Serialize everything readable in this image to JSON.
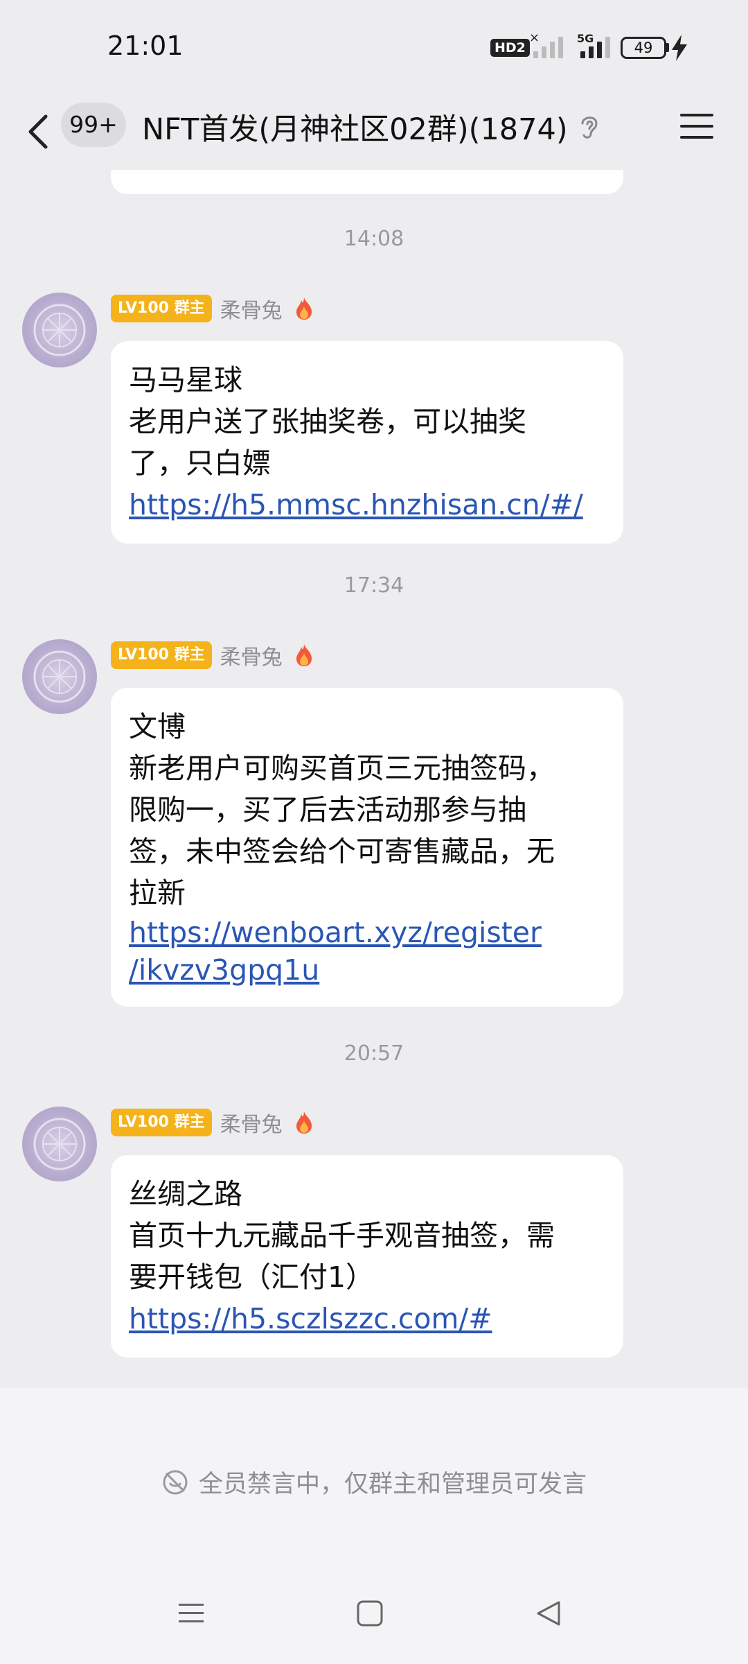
{
  "status_bar": {
    "time": "21:01",
    "hd_label": "HD2",
    "network_label": "5G",
    "battery": "49"
  },
  "header": {
    "unread_count": "99+",
    "title": "NFT首发(月神社区02群)(1874)"
  },
  "messages": [
    {
      "timestamp": "14:08",
      "badge": "LV100 群主",
      "sender": "柔骨兔",
      "lines": [
        "马马星球",
        "老用户送了张抽奖卷，可以抽奖",
        "了，只白嫖"
      ],
      "links": [
        "https://h5.mmsc.hnzhisan.cn/#/"
      ]
    },
    {
      "timestamp": "17:34",
      "badge": "LV100 群主",
      "sender": "柔骨兔",
      "lines": [
        "文博",
        "新老用户可购买首页三元抽签码，",
        "限购一，买了后去活动那参与抽",
        "签，未中签会给个可寄售藏品，无",
        "拉新"
      ],
      "links": [
        "https://wenboart.xyz/register",
        "/ikvzv3gpq1u"
      ]
    },
    {
      "timestamp": "20:57",
      "badge": "LV100 群主",
      "sender": "柔骨兔",
      "lines": [
        "丝绸之路",
        "首页十九元藏品千手观音抽签，需",
        "要开钱包（汇付1）"
      ],
      "links": [
        "https://h5.sczlszzc.com/#"
      ]
    }
  ],
  "footer": {
    "mute_notice": "全员禁言中，仅群主和管理员可发言"
  },
  "icons": {
    "back": "chevron-left-icon",
    "ear": "ear-icon",
    "menu": "hamburger-menu-icon",
    "fire": "fire-icon",
    "mute": "mute-icon"
  },
  "colors": {
    "background": "#EDEDF0",
    "badge": "#F5B21A",
    "link": "#2A55B4",
    "timestamp": "#9A9A9E"
  }
}
